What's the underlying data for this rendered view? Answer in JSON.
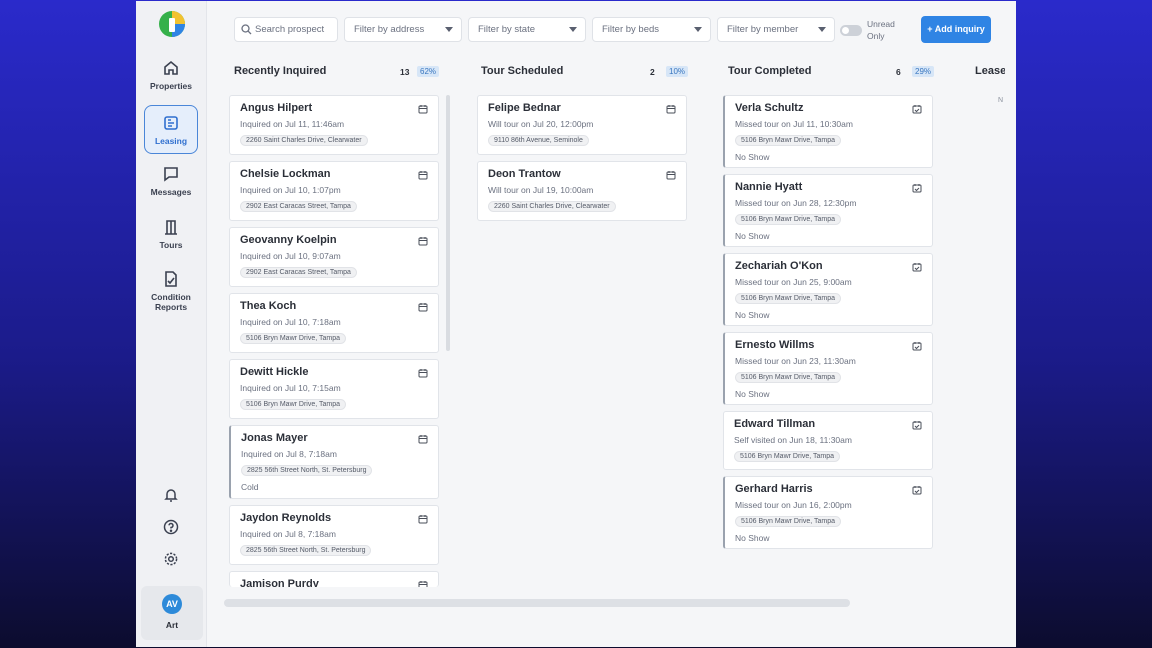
{
  "sidebar": {
    "items": [
      {
        "label": "Properties",
        "icon": "home-icon"
      },
      {
        "label": "Leasing",
        "icon": "board-icon"
      },
      {
        "label": "Messages",
        "icon": "chat-icon"
      },
      {
        "label": "Tours",
        "icon": "door-icon"
      },
      {
        "label": "Condition Reports",
        "icon": "report-icon"
      }
    ],
    "active": "Leasing",
    "user": {
      "initials": "AV",
      "name": "Art"
    }
  },
  "toolbar": {
    "search_placeholder": "Search prospect",
    "filter_address": "Filter by address",
    "filter_state": "Filter by state",
    "filter_beds": "Filter by beds",
    "filter_member": "Filter by member",
    "unread_label": "Unread Only",
    "add_label": "Add inquiry"
  },
  "columns": [
    {
      "title": "Recently Inquired",
      "count": "13",
      "pct": "62%",
      "cards": [
        {
          "name": "Angus Hilpert",
          "sub": "Inquired on Jul 11, 11:46am",
          "addr": "2260 Saint Charles Drive, Clearwater"
        },
        {
          "name": "Chelsie Lockman",
          "sub": "Inquired on Jul 10, 1:07pm",
          "addr": "2902 East Caracas Street, Tampa"
        },
        {
          "name": "Geovanny Koelpin",
          "sub": "Inquired on Jul 10, 9:07am",
          "addr": "2902 East Caracas Street, Tampa"
        },
        {
          "name": "Thea Koch",
          "sub": "Inquired on Jul 10, 7:18am",
          "addr": "5106 Bryn Mawr Drive, Tampa"
        },
        {
          "name": "Dewitt Hickle",
          "sub": "Inquired on Jul 10, 7:15am",
          "addr": "5106 Bryn Mawr Drive, Tampa"
        },
        {
          "name": "Jonas Mayer",
          "sub": "Inquired on Jul 8, 7:18am",
          "addr": "2825 56th Street North, St. Petersburg",
          "tag": "Cold"
        },
        {
          "name": "Jaydon Reynolds",
          "sub": "Inquired on Jul 8, 7:18am",
          "addr": "2825 56th Street North, St. Petersburg"
        },
        {
          "name": "Jamison Purdy"
        }
      ]
    },
    {
      "title": "Tour Scheduled",
      "count": "2",
      "pct": "10%",
      "cards": [
        {
          "name": "Felipe Bednar",
          "sub": "Will tour on Jul 20, 12:00pm",
          "addr": "9110 86th Avenue, Seminole"
        },
        {
          "name": "Deon Trantow",
          "sub": "Will tour on Jul 19, 10:00am",
          "addr": "2260 Saint Charles Drive, Clearwater"
        }
      ]
    },
    {
      "title": "Tour Completed",
      "count": "6",
      "pct": "29%",
      "cards": [
        {
          "name": "Verla Schultz",
          "sub": "Missed tour on Jul 11, 10:30am",
          "addr": "5106 Bryn Mawr Drive, Tampa",
          "tag": "No Show"
        },
        {
          "name": "Nannie Hyatt",
          "sub": "Missed tour on Jun 28, 12:30pm",
          "addr": "5106 Bryn Mawr Drive, Tampa",
          "tag": "No Show"
        },
        {
          "name": "Zechariah O'Kon",
          "sub": "Missed tour on Jun 25, 9:00am",
          "addr": "5106 Bryn Mawr Drive, Tampa",
          "tag": "No Show"
        },
        {
          "name": "Ernesto Willms",
          "sub": "Missed tour on Jun 23, 11:30am",
          "addr": "5106 Bryn Mawr Drive, Tampa",
          "tag": "No Show"
        },
        {
          "name": "Edward Tillman",
          "sub": "Self visited on Jun 18, 11:30am",
          "addr": "5106 Bryn Mawr Drive, Tampa"
        },
        {
          "name": "Gerhard Harris",
          "sub": "Missed tour on Jun 16, 2:00pm",
          "addr": "5106 Bryn Mawr Drive, Tampa",
          "tag": "No Show"
        }
      ]
    },
    {
      "title": "Lease",
      "mark": "N"
    }
  ],
  "colors": {
    "accent": "#2f84e4",
    "active_nav": "#4a86d8",
    "pct_bg": "#d7e6f7"
  }
}
